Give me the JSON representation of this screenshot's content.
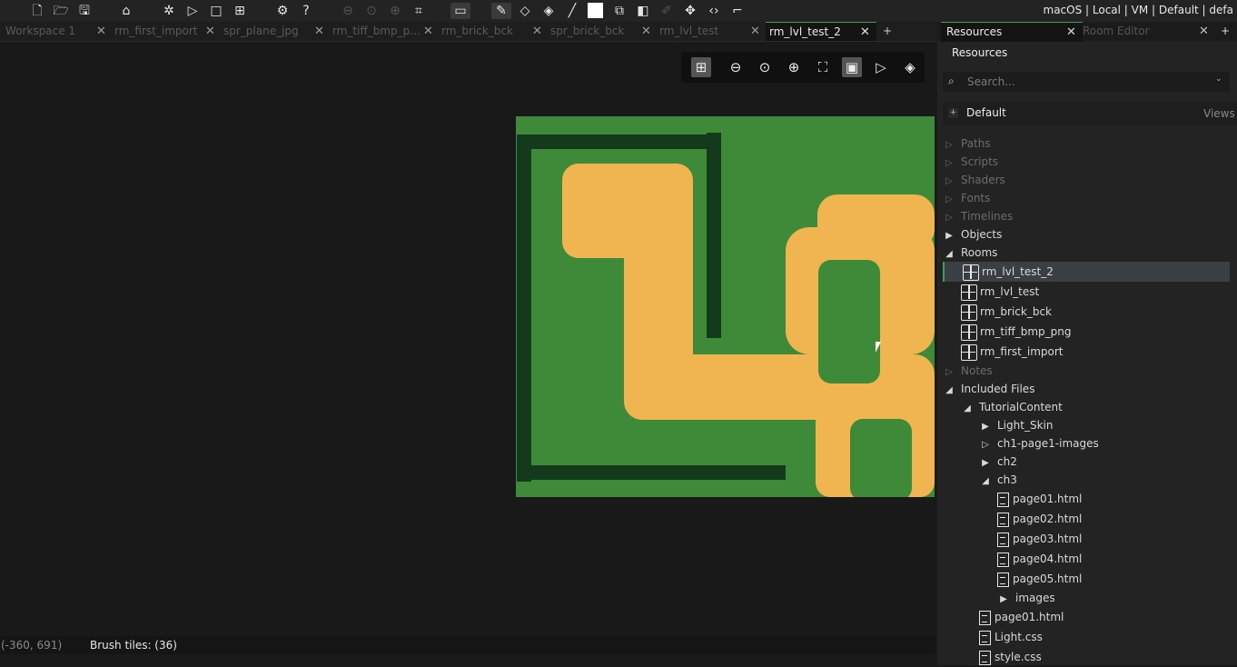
{
  "toolbar": {
    "status_right": "macOS | Local | VM | Default | defa",
    "icons": [
      "new-file",
      "open-folder",
      "save",
      "clean",
      "debug",
      "run",
      "stop",
      "create-exe",
      "preferences",
      "help",
      "zoom-out",
      "zoom-reset",
      "zoom-in",
      "layout",
      "desktop",
      "pencil",
      "eraser",
      "fill",
      "line",
      "rect-color",
      "region",
      "toggle",
      "picker",
      "move",
      "code",
      "draw"
    ]
  },
  "doc_tabs": [
    {
      "label": "Workspace 1"
    },
    {
      "label": "rm_first_import"
    },
    {
      "label": "spr_plane_jpg"
    },
    {
      "label": "rm_tiff_bmp_p..."
    },
    {
      "label": "rm_brick_bck"
    },
    {
      "label": "spr_brick_bck"
    },
    {
      "label": "rm_lvl_test"
    },
    {
      "label": "rm_lvl_test_2",
      "active": true
    }
  ],
  "add_tab": "+",
  "status": {
    "coords": "(-360, 691)",
    "brush": "Brush tiles: (36)"
  },
  "right_panel": {
    "tabs": [
      {
        "label": "Resources",
        "active": true
      },
      {
        "label": "Room Editor"
      }
    ],
    "title": "Resources",
    "search_placeholder": "Search...",
    "default_label": "Default",
    "views_label": "Views",
    "tree": [
      {
        "label": "Paths",
        "dim": true,
        "arrow": "▷",
        "depth": 0
      },
      {
        "label": "Scripts",
        "dim": true,
        "arrow": "▷",
        "depth": 0
      },
      {
        "label": "Shaders",
        "dim": true,
        "arrow": "▷",
        "depth": 0
      },
      {
        "label": "Fonts",
        "dim": true,
        "arrow": "▷",
        "depth": 0
      },
      {
        "label": "Timelines",
        "dim": true,
        "arrow": "▷",
        "depth": 0
      },
      {
        "label": "Objects",
        "arrow": "▶",
        "depth": 0
      },
      {
        "label": "Rooms",
        "arrow": "◢",
        "depth": 0
      },
      {
        "label": "rm_lvl_test_2",
        "icon": "room",
        "selected": true,
        "depth": 1
      },
      {
        "label": "rm_lvl_test",
        "icon": "room",
        "depth": 1
      },
      {
        "label": "rm_brick_bck",
        "icon": "room",
        "depth": 1
      },
      {
        "label": "rm_tiff_bmp_png",
        "icon": "room",
        "depth": 1
      },
      {
        "label": "rm_first_import",
        "icon": "room",
        "depth": 1
      },
      {
        "label": "Notes",
        "dim": true,
        "arrow": "▷",
        "depth": 0
      },
      {
        "label": "Included Files",
        "arrow": "◢",
        "depth": 0
      },
      {
        "label": "TutorialContent",
        "arrow": "◢",
        "depth": 1
      },
      {
        "label": "Light_Skin",
        "arrow": "▶",
        "depth": 2
      },
      {
        "label": "ch1-page1-images",
        "arrow": "▷",
        "depth": 2
      },
      {
        "label": "ch2",
        "arrow": "▶",
        "depth": 2
      },
      {
        "label": "ch3",
        "arrow": "◢",
        "depth": 2
      },
      {
        "label": "page01.html",
        "icon": "file",
        "depth": 3
      },
      {
        "label": "page02.html",
        "icon": "file",
        "depth": 3
      },
      {
        "label": "page03.html",
        "icon": "file",
        "depth": 3
      },
      {
        "label": "page04.html",
        "icon": "file",
        "depth": 3
      },
      {
        "label": "page05.html",
        "icon": "file",
        "depth": 3
      },
      {
        "label": "images",
        "arrow": "▶",
        "depth": 3
      },
      {
        "label": "page01.html",
        "icon": "file",
        "depth": 2
      },
      {
        "label": "Light.css",
        "icon": "file",
        "depth": 2
      },
      {
        "label": "style.css",
        "icon": "file",
        "depth": 2
      }
    ]
  }
}
